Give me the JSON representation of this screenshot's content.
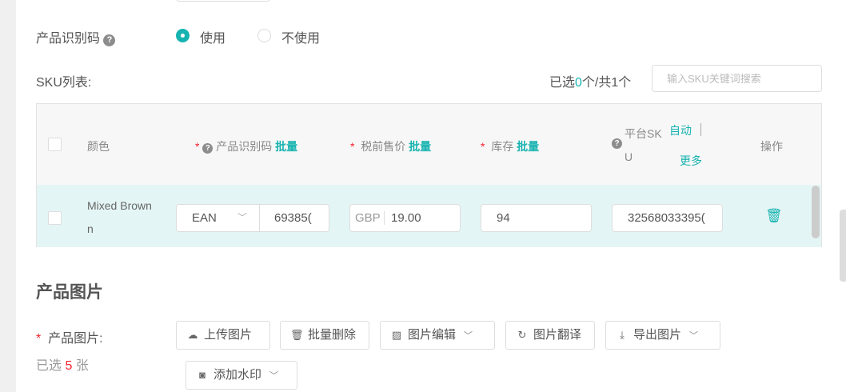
{
  "identifier": {
    "label": "产品识别码",
    "options": [
      {
        "label": "使用",
        "selected": true
      },
      {
        "label": "不使用",
        "selected": false
      }
    ]
  },
  "sku": {
    "label": "SKU列表:",
    "selected_prefix": "已选",
    "selected_count": "0",
    "selected_mid": "个/共",
    "total": "1",
    "selected_suffix": "个",
    "search_placeholder": "输入SKU关键词搜索"
  },
  "table": {
    "headers": {
      "color": "颜色",
      "identifier": "产品识别码",
      "price": "税前售价",
      "stock": "库存",
      "platform_sku_1": "平台SK",
      "platform_sku_2": "U",
      "actions": "操作",
      "bulk": "批量",
      "auto": "自动",
      "more": "更多"
    },
    "rows": [
      {
        "color": "Mixed Brown",
        "color_wrap": "n",
        "id_type": "EAN",
        "id_value": "69385(",
        "currency": "GBP",
        "price": "19.00",
        "stock": "94",
        "platform_sku": "32568033395("
      }
    ]
  },
  "images": {
    "section_title": "产品图片",
    "label": "产品图片:",
    "selected_prefix": "已选",
    "selected_count": "5",
    "selected_suffix": "张",
    "buttons": {
      "upload": "上传图片",
      "bulk_delete": "批量删除",
      "edit": "图片编辑",
      "translate": "图片翻译",
      "export": "导出图片",
      "watermark": "添加水印"
    }
  },
  "colors": {
    "accent": "#17b3b0",
    "required": "#f5222d",
    "row_bg": "#e4f5f5"
  }
}
